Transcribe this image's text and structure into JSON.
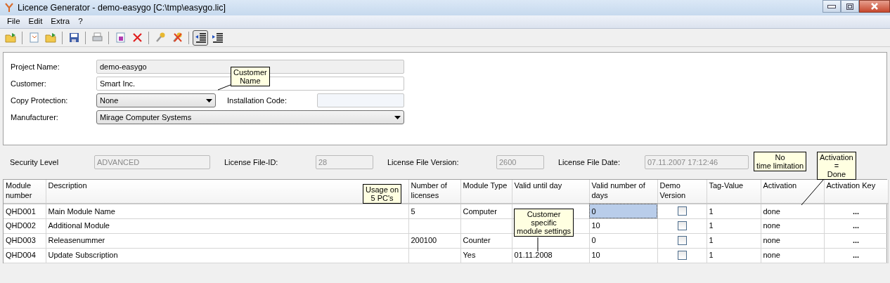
{
  "window": {
    "title": "Licence Generator - demo-easygo [C:\\tmp\\easygo.lic]"
  },
  "menu": [
    "File",
    "Edit",
    "Extra",
    "?"
  ],
  "toolbar": [
    {
      "kind": "open",
      "selected": false
    },
    {
      "kind": "sep"
    },
    {
      "kind": "new",
      "selected": false
    },
    {
      "kind": "folder",
      "selected": false
    },
    {
      "kind": "sep"
    },
    {
      "kind": "save",
      "selected": false
    },
    {
      "kind": "sep"
    },
    {
      "kind": "print",
      "selected": false
    },
    {
      "kind": "sep"
    },
    {
      "kind": "export",
      "selected": false
    },
    {
      "kind": "delete",
      "selected": false
    },
    {
      "kind": "sep"
    },
    {
      "kind": "key",
      "selected": false
    },
    {
      "kind": "keydel",
      "selected": false
    },
    {
      "kind": "sep"
    },
    {
      "kind": "outdent",
      "selected": true
    },
    {
      "kind": "indent",
      "selected": false
    }
  ],
  "project": {
    "project_name_label": "Project Name:",
    "project_name": "demo-easygo",
    "customer_label": "Customer:",
    "customer": "Smart Inc.",
    "copy_protection_label": "Copy Protection:",
    "copy_protection": "None",
    "installation_code_label": "Installation Code:",
    "manufacturer_label": "Manufacturer:",
    "manufacturer": "Mirage Computer Systems"
  },
  "info": [
    {
      "label": "Security Level",
      "value": "ADVANCED"
    },
    {
      "label": "License File-ID:",
      "value": "28"
    },
    {
      "label": "License File Version:",
      "value": "2600"
    },
    {
      "label": "License File Date:",
      "value": "07.11.2007 17:12:46"
    }
  ],
  "table": {
    "columns": [
      "Module number",
      "Description",
      "Number of licenses",
      "Module Type",
      "Valid until day",
      "Valid number of days",
      "Demo Version",
      "Tag-Value",
      "Activation",
      "Activation Key"
    ],
    "rows": [
      {
        "module": "QHD001",
        "description": "Main Module Name",
        "licenses": "5",
        "type": "Computer",
        "until": null,
        "days": "0",
        "days_selected": true,
        "demo": false,
        "tag": "1",
        "activation": "done",
        "key": "..."
      },
      {
        "module": "QHD002",
        "description": "Additional Module",
        "licenses": null,
        "type": null,
        "until": null,
        "days": "10",
        "days_selected": false,
        "demo": false,
        "tag": "1",
        "activation": "none",
        "key": "..."
      },
      {
        "module": "QHD003",
        "description": "Releasenummer",
        "licenses": "200100",
        "type": "Counter",
        "until": null,
        "days": "0",
        "days_selected": false,
        "demo": false,
        "tag": "1",
        "activation": "none",
        "key": "..."
      },
      {
        "module": "QHD004",
        "description": "Update Subscription",
        "licenses": null,
        "type": "Yes",
        "until": "01.11.2008",
        "days": "10",
        "days_selected": false,
        "demo": false,
        "tag": "1",
        "activation": "none",
        "key": "..."
      }
    ]
  },
  "callouts": [
    {
      "kind": "customer",
      "text": "Customer\nName"
    },
    {
      "kind": "usage",
      "text": "Usage on\n5 PC's"
    },
    {
      "kind": "notime",
      "text": "No\ntime limitation"
    },
    {
      "kind": "activation",
      "text": "Activation\n=\nDone"
    },
    {
      "kind": "module",
      "text": "Customer\nspecific\nmodule settings"
    }
  ]
}
